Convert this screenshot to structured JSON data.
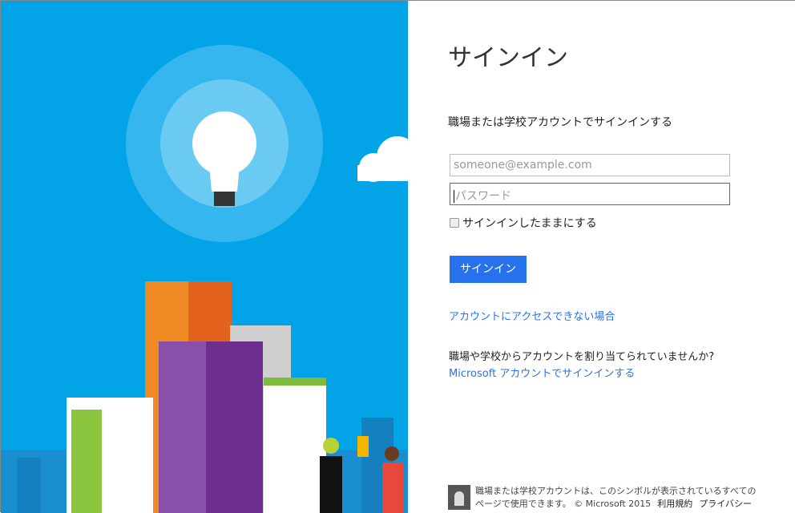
{
  "signin": {
    "title": "サインイン",
    "subtitle": "職場または学校アカウントでサインインする",
    "email_placeholder": "someone@example.com",
    "password_placeholder": "パスワード",
    "keep_signed_in": "サインインしたままにする",
    "signin_button": "サインイン",
    "cant_access": "アカウントにアクセスできない場合",
    "question": "職場や学校からアカウントを割り当てられていませんか?",
    "ms_account_link": "Microsoft アカウントでサインインする"
  },
  "footer": {
    "line1": "職場または学校アカウントは、このシンボルが表示されているすべての",
    "line2": "ページで使用できます。 © Microsoft 2015",
    "terms": "利用規約",
    "privacy": "プライバシー"
  },
  "colors": {
    "accent": "#2672ec",
    "sky": "#02a3e7"
  }
}
